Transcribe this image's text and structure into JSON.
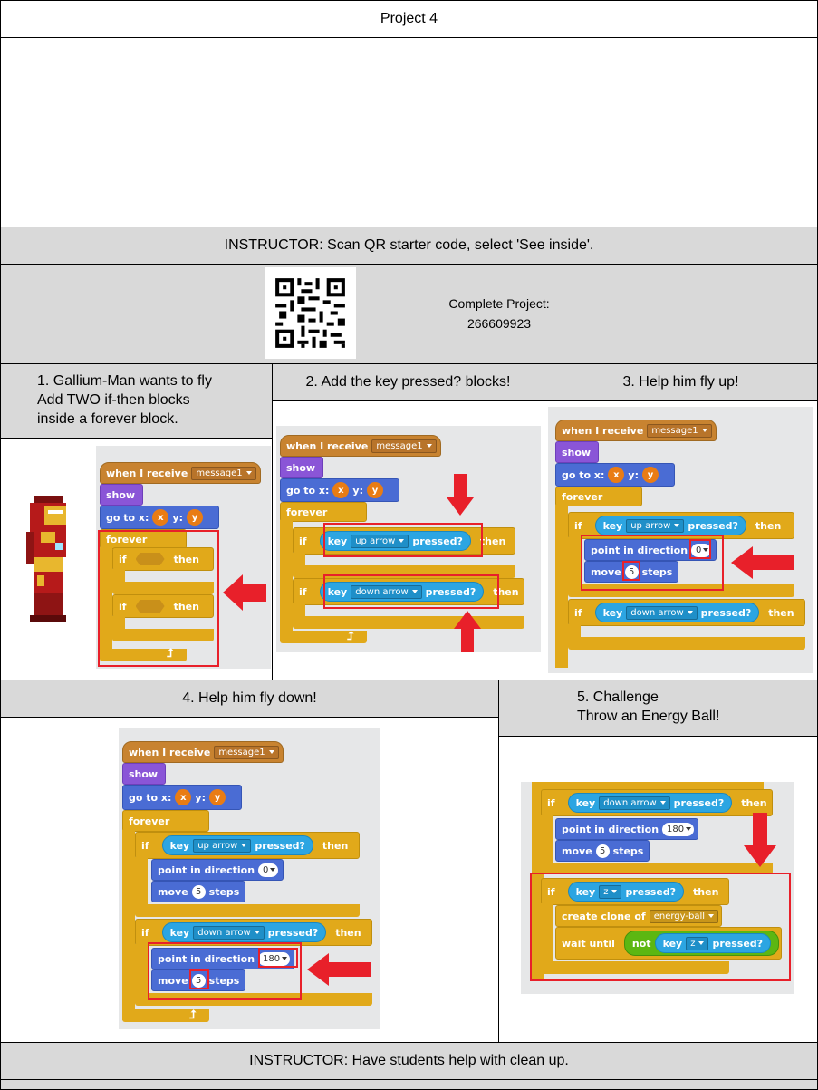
{
  "title": "Project 4",
  "instructor_top": "INSTRUCTOR: Scan QR starter code, select 'See inside'.",
  "complete_label": "Complete Project:",
  "complete_id": "266609923",
  "steps": [
    {
      "lines": [
        "1. Gallium-Man wants to fly",
        "Add TWO if-then blocks",
        "inside a forever block."
      ]
    },
    {
      "lines": [
        "2. Add the key pressed? blocks!"
      ]
    },
    {
      "lines": [
        "3. Help him fly up!"
      ]
    },
    {
      "lines": [
        "4. Help him fly down!"
      ]
    },
    {
      "lines": [
        "5. Challenge",
        "Throw an Energy Ball!"
      ]
    }
  ],
  "instructor_bottom": "INSTRUCTOR: Have students help with clean up.",
  "blocks": {
    "when_receive": "when I receive",
    "message": "message1",
    "show": "show",
    "goto_x": "go to x:",
    "goto_y": "y:",
    "x_var": "x",
    "y_var": "y",
    "forever": "forever",
    "if": "if",
    "then": "then",
    "key": "key",
    "up_arrow": "up arrow",
    "down_arrow": "down arrow",
    "key_z": "z",
    "pressed": "pressed?",
    "point_dir": "point in direction",
    "dir_0": "0",
    "dir_180": "180",
    "move": "move",
    "steps": "steps",
    "steps_val": "5",
    "create_clone": "create clone of",
    "energy_ball": "energy-ball",
    "wait_until": "wait until",
    "not": "not"
  },
  "colors": {
    "event": "#c88330",
    "looks": "#8a55d7",
    "motion": "#4a6cd4",
    "control": "#e1a91a",
    "sensing": "#2ca5e2",
    "operator": "#5cb712",
    "highlight": "#e8202a",
    "header_gray": "#d9d9d9"
  }
}
